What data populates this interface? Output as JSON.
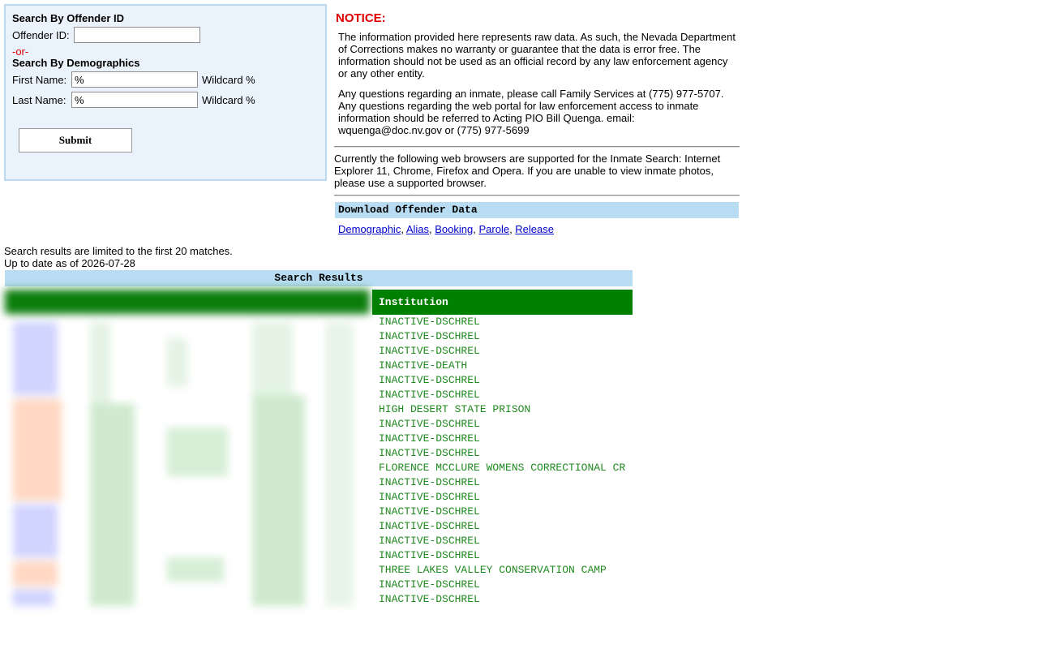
{
  "search": {
    "offender_id_heading": "Search By Offender ID",
    "offender_id_label": "Offender ID:",
    "offender_id_value": "",
    "or_text": "-or-",
    "demographics_heading": "Search By Demographics",
    "first_name_label": "First Name:",
    "first_name_value": "%",
    "last_name_label": "Last Name:",
    "last_name_value": "%",
    "wildcard_text": "Wildcard %",
    "submit_label": "Submit"
  },
  "notice": {
    "title": "NOTICE:",
    "paragraph1": "The information provided here represents raw data. As such, the Nevada Department of Corrections makes no warranty or guarantee that the data is error free. The information should not be used as an official record by any law enforcement agency or any other entity.",
    "paragraph2": "Any questions regarding an inmate, please call Family Services at (775) 977-5707. Any questions regarding the web portal for law enforcement access to inmate information should be referred to Acting PIO Bill Quenga. email: wquenga@doc.nv.gov or (775) 977-5699",
    "browsers": "Currently the following web browsers are supported for the Inmate Search: Internet Explorer 11, Chrome, Firefox and Opera. If you are unable to view inmate photos, please use a supported browser."
  },
  "download": {
    "heading": "Download Offender Data",
    "links": [
      "Demographic",
      "Alias",
      "Booking",
      "Parole",
      "Release"
    ]
  },
  "results": {
    "limit_text": "Search results are limited to the first 20 matches.",
    "updated_text": "Up to date as of 2026-07-28",
    "heading": "Search Results",
    "institution_header": "Institution",
    "institutions": [
      "INACTIVE-DSCHREL",
      "INACTIVE-DSCHREL",
      "INACTIVE-DSCHREL",
      "INACTIVE-DEATH",
      "INACTIVE-DSCHREL",
      "INACTIVE-DSCHREL",
      "HIGH DESERT STATE PRISON",
      "INACTIVE-DSCHREL",
      "INACTIVE-DSCHREL",
      "INACTIVE-DSCHREL",
      "FLORENCE MCCLURE WOMENS CORRECTIONAL CR",
      "INACTIVE-DSCHREL",
      "INACTIVE-DSCHREL",
      "INACTIVE-DSCHREL",
      "INACTIVE-DSCHREL",
      "INACTIVE-DSCHREL",
      "INACTIVE-DSCHREL",
      "THREE LAKES VALLEY CONSERVATION CAMP",
      "INACTIVE-DSCHREL",
      "INACTIVE-DSCHREL"
    ]
  },
  "colors": {
    "notice_red": "#e00000",
    "header_green": "#008000",
    "bar_blue": "#b8dcf2",
    "panel_bg": "#eaf3fb"
  }
}
